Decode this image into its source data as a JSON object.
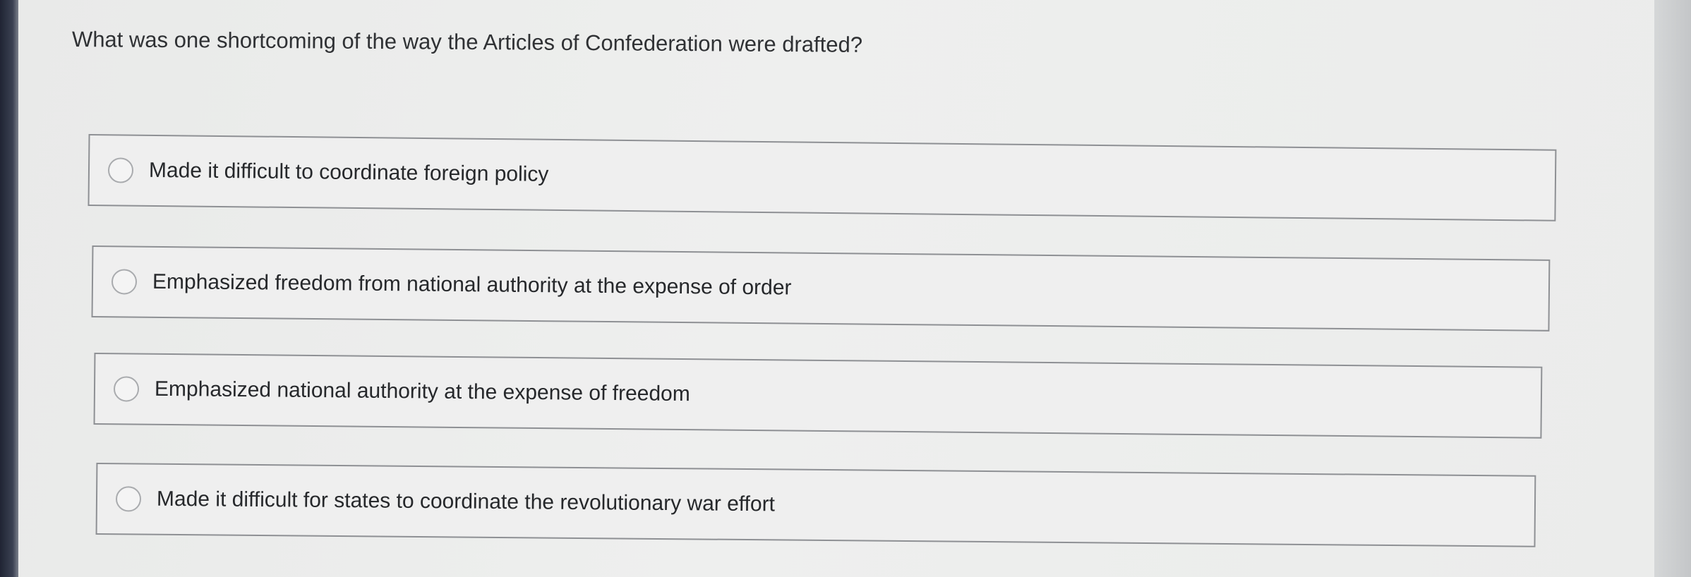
{
  "question": {
    "text": "What was one shortcoming of the way the Articles of Confederation were drafted?"
  },
  "choices": [
    {
      "label": "Made it difficult to coordinate foreign policy",
      "selected": false
    },
    {
      "label": "Emphasized freedom from national authority at the expense of order",
      "selected": false
    },
    {
      "label": "Emphasized national authority at the expense of freedom",
      "selected": false
    },
    {
      "label": "Made it difficult for states to coordinate the revolutionary war effort",
      "selected": false
    }
  ],
  "colors": {
    "page_background": "#eeefee",
    "option_border": "#8e9094",
    "text": "#2f3134"
  },
  "icons": {
    "radio": "radio-unchecked-icon"
  }
}
